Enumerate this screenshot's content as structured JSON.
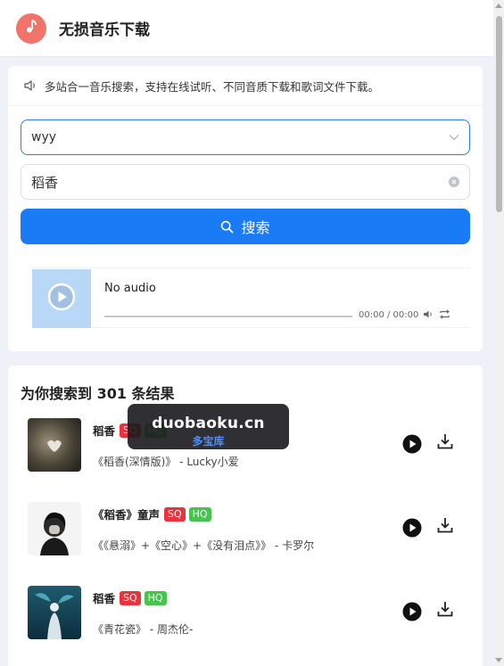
{
  "header": {
    "title": "无损音乐下载",
    "logo_icon": "music-note-icon"
  },
  "notice": {
    "text": "多站合一音乐搜索，支持在线试听、不同音质下载和歌词文件下载。",
    "icon": "speaker-icon"
  },
  "search": {
    "source_value": "wyy",
    "keyword_value": "稻香",
    "button_label": "搜索"
  },
  "player": {
    "title": "No audio",
    "time": "00:00 / 00:00",
    "progress": 0
  },
  "results": {
    "heading": "为你搜索到 301 条结果",
    "items": [
      {
        "name": "稻香",
        "badges": [
          "SQ",
          "HQ"
        ],
        "meta": "《稻香(深情版)》 - Lucky小爱"
      },
      {
        "name": "《稻香》童声",
        "badges": [
          "SQ",
          "HQ"
        ],
        "meta": "《《悬溺》+《空心》+《没有泪点》》 - 卡罗尔"
      },
      {
        "name": "稻香",
        "badges": [
          "SQ",
          "HQ"
        ],
        "meta": "《青花瓷》 - 周杰伦-"
      }
    ]
  },
  "watermark": {
    "main": "duobaoku.cn",
    "sub": "多宝库"
  },
  "colors": {
    "accent": "#1a7bf6",
    "logo": "#f2736a",
    "sq_badge": "#e8323c",
    "hq_badge": "#46c44d"
  }
}
